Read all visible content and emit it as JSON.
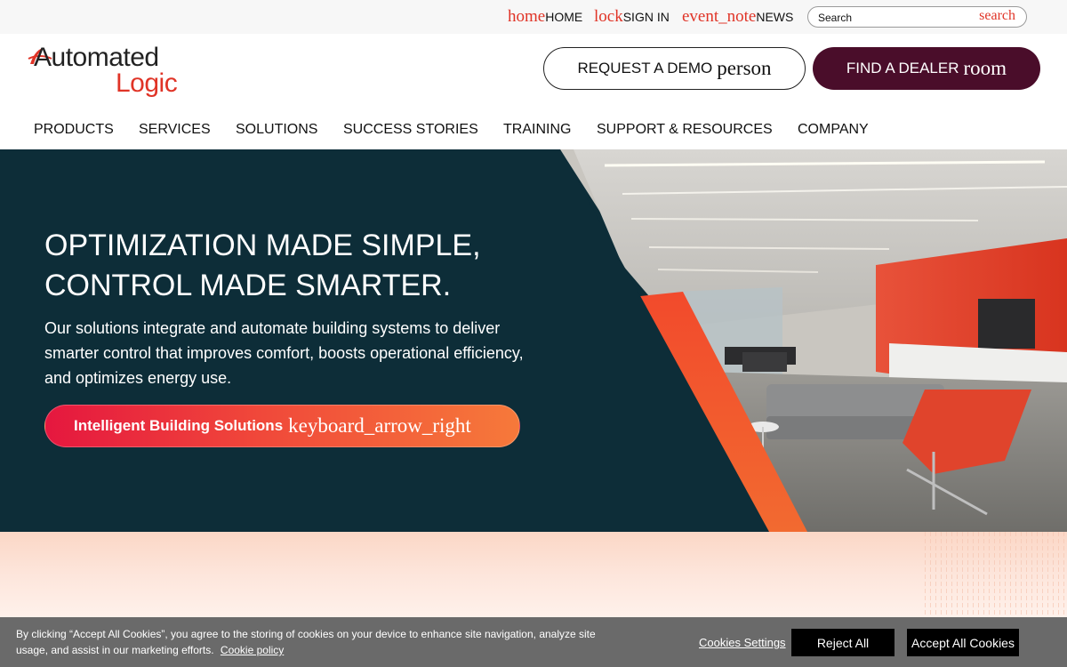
{
  "utility_nav": {
    "home": {
      "glyph": "home",
      "label": "HOME"
    },
    "sign_in": {
      "glyph": "lock",
      "label": "SIGN IN"
    },
    "news": {
      "glyph": "event_note",
      "label": "NEWS"
    },
    "search": {
      "placeholder": "Search",
      "glyph": "search"
    }
  },
  "logo": {
    "line1": "Automated",
    "line2": "Logic"
  },
  "header_buttons": {
    "demo": {
      "label": "REQUEST A DEMO",
      "glyph": "person"
    },
    "dealer": {
      "label": "FIND A DEALER",
      "glyph": "room"
    }
  },
  "main_nav": [
    "PRODUCTS",
    "SERVICES",
    "SOLUTIONS",
    "SUCCESS STORIES",
    "TRAINING",
    "SUPPORT & RESOURCES",
    "COMPANY"
  ],
  "hero": {
    "title_line1": "OPTIMIZATION MADE SIMPLE,",
    "title_line2": "CONTROL MADE SMARTER.",
    "body": "Our solutions integrate and automate building systems to deliver smarter control that improves comfort, boosts operational efficiency, and optimizes energy use.",
    "cta_label": "Intelligent Building Solutions",
    "cta_glyph": "keyboard_arrow_right"
  },
  "cookie_banner": {
    "text": "By clicking “Accept All Cookies”, you agree to the storing of cookies on your device to enhance site navigation, analyze site usage, and assist in our marketing efforts.",
    "policy_link": "Cookie policy",
    "settings_label": "Cookies Settings",
    "reject_label": "Reject All",
    "accept_label": "Accept All Cookies"
  },
  "colors": {
    "accent_red": "#e03427",
    "dealer_button": "#4a0d2a",
    "hero_background": "#0d2d38",
    "cookie_banner": "#6a6a6a"
  }
}
